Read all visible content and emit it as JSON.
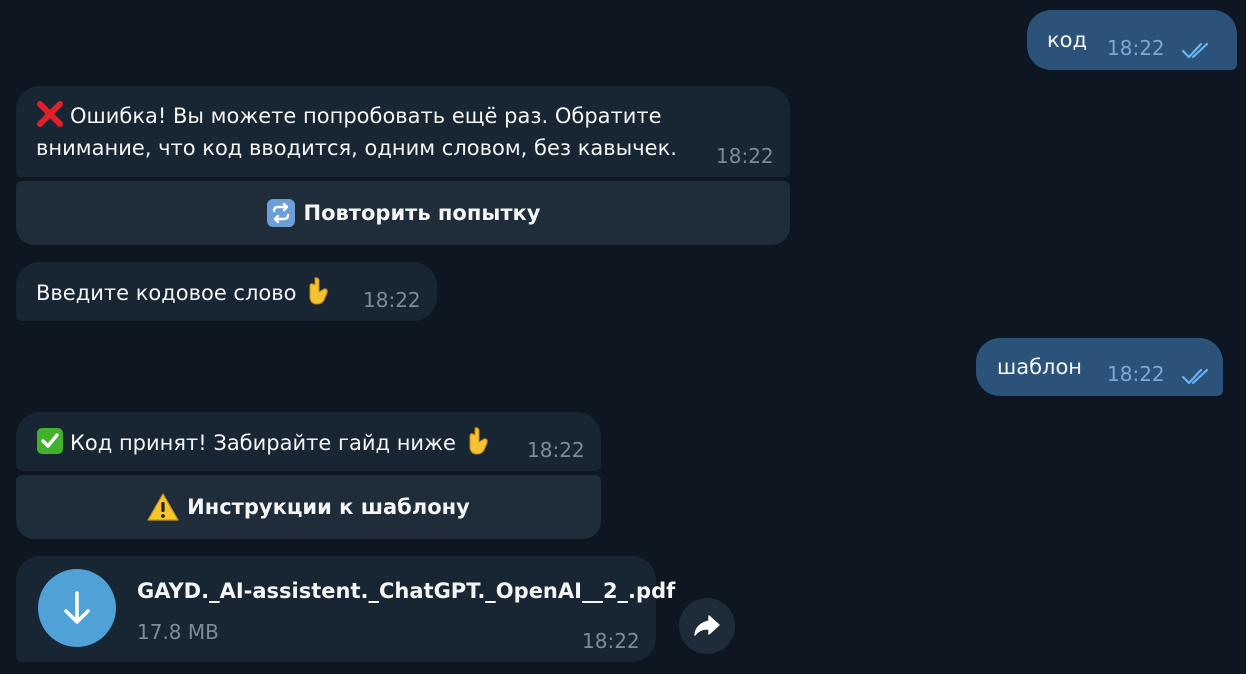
{
  "messages": {
    "out1": {
      "text": "код",
      "time": "18:22"
    },
    "in_error": {
      "line1": "Ошибка! Вы можете попробовать ещё раз. Обратите",
      "line2": "внимание, что код вводится, одним словом, без кавычек.",
      "time": "18:22",
      "button_label": "Повторить попытку"
    },
    "in_prompt": {
      "text": "Введите кодовое слово",
      "time": "18:22"
    },
    "out2": {
      "text": "шаблон",
      "time": "18:22"
    },
    "in_success": {
      "text": "Код принят! Забирайте гайд ниже",
      "time": "18:22",
      "button_label": "Инструкции к шаблону"
    },
    "file": {
      "name": "GAYD._AI-assistent._ChatGPT._OpenAI__2_.pdf",
      "size": "17.8 MB",
      "time": "18:22"
    }
  },
  "colors": {
    "background": "#0e1621",
    "outgoing_bubble": "#2b5278",
    "incoming_bubble": "#182533",
    "inline_button": "#1f2c3a",
    "accent_blue": "#4fa1d8",
    "read_ticks": "#6ab3f3"
  },
  "icons": {
    "error": "red-cross-mark-icon",
    "success": "green-check-mark-icon",
    "pointing_down": "pointing-down-hand-icon",
    "repeat": "repeat-arrows-icon",
    "warning": "warning-sign-icon",
    "download": "download-arrow-icon",
    "share": "share-arrow-icon",
    "read_status": "double-check-icon"
  }
}
